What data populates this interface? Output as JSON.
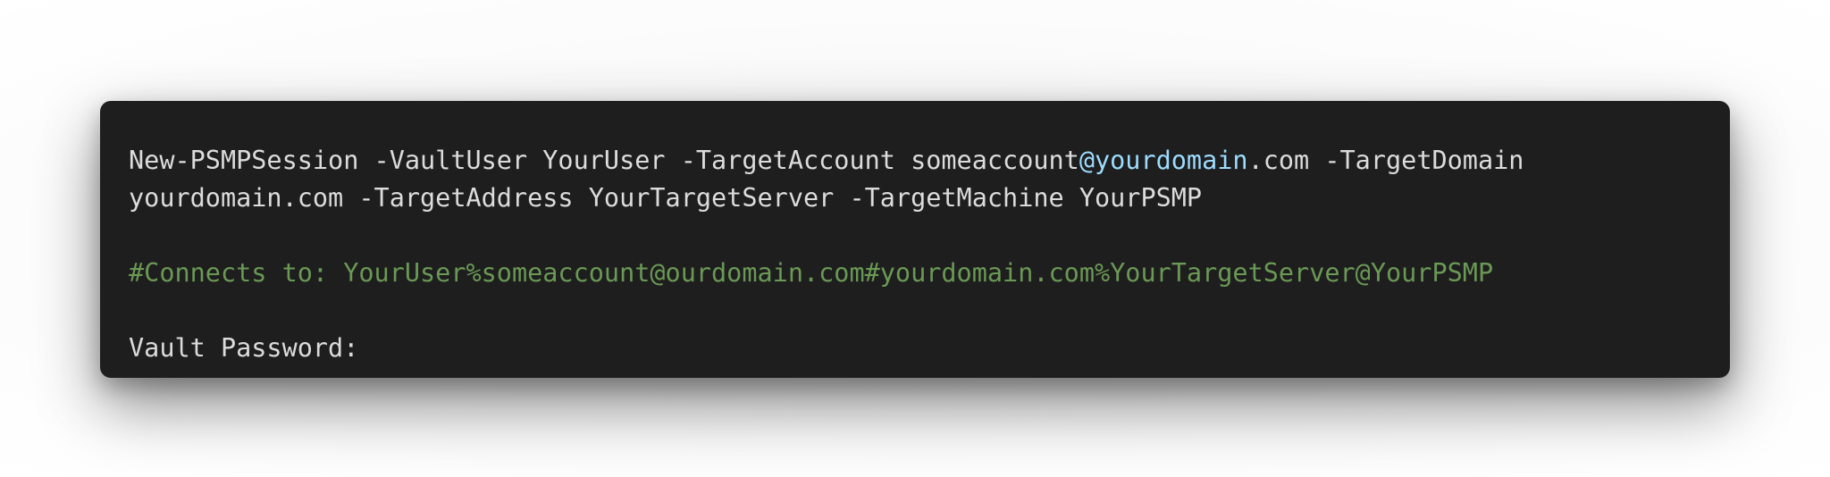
{
  "terminal": {
    "command_line1": {
      "prefix": "New-PSMPSession -VaultUser YourUser -TargetAccount someaccount",
      "highlight": "@yourdomain",
      "suffix": ".com -TargetDomain"
    },
    "command_line2": "yourdomain.com -TargetAddress YourTargetServer -TargetMachine YourPSMP",
    "comment": "#Connects to: YourUser%someaccount@ourdomain.com#yourdomain.com%YourTargetServer@YourPSMP",
    "prompt": "Vault Password:"
  },
  "colors": {
    "background": "#1e1e1e",
    "text": "#dcdcdc",
    "comment": "#6a9955",
    "highlight": "#9cdcfe"
  }
}
